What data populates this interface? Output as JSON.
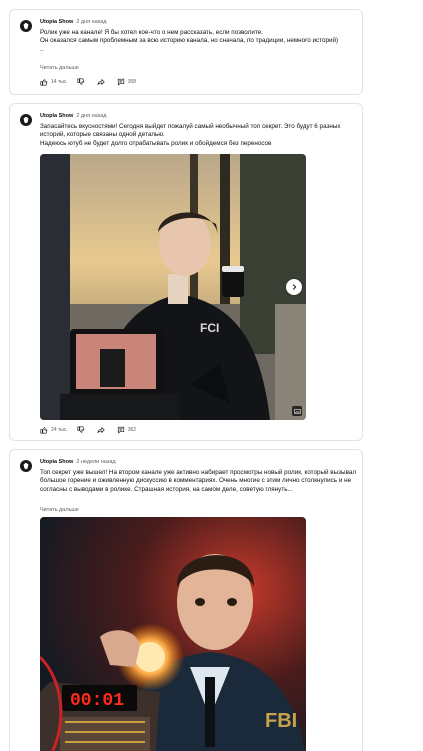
{
  "icons": {
    "avatar": "channel-avatar-icon",
    "like": "thumbs-up-icon",
    "dislike": "thumbs-down-icon",
    "share": "share-icon",
    "comments": "comments-icon",
    "next": "chevron-right-icon",
    "gallery": "gallery-icon"
  },
  "posts": [
    {
      "channel": "Utopia Show",
      "time": "2 дня назад",
      "text": "Ролик уже на канале! Я бы хотел кое-что о нем рассказать, если позволите.\nОн оказался самым проблемным за всю историю канала, но сначала, по традиции, немного историй)\n..",
      "read_more": "Читать дальше",
      "likes": "14 тыс.",
      "comments": "358"
    },
    {
      "channel": "Utopia Show",
      "time": "2 дня назад",
      "text": "Запасайтесь вкусностями! Сегодня выйдет пожалуй самый необычный топ секрет. Это будут 6 разных историй, которые связаны одной деталью.\nНадеюсь ютуб не будет долго отрабатывать ролик и обойдемся без переносов",
      "likes": "24 тыс.",
      "comments": "362"
    },
    {
      "channel": "Utopia Show",
      "time": "2 недели назад",
      "text": "Топ секрет уже вышел! На втором канале уже активно набирает просмотры новый ролик, который вызывал большое горение и оживленную дискуссию в комментариях. Очень многие с этим лично столкнулись и не согласны с выводами в ролике. Страшная история, на самом деле, советую глянуть...",
      "read_more": "Читать дальше"
    }
  ],
  "colors": {
    "text": "#0f0f0f",
    "secondary": "#606060",
    "border": "#e3e3e3",
    "timer_red": "#ff2a1a"
  },
  "timer": "00:01"
}
